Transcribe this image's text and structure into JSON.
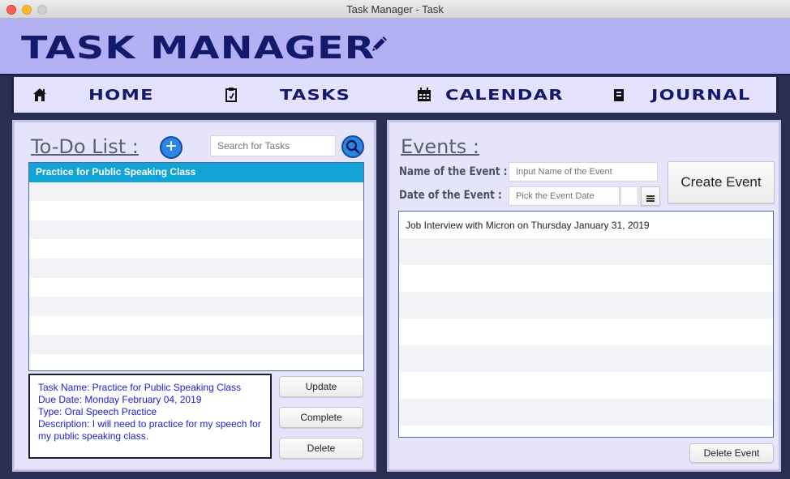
{
  "window": {
    "title": "Task Manager - Task"
  },
  "header": {
    "brand": "TASK MANAGER",
    "brand_icon": "pencil-icon"
  },
  "nav": [
    {
      "label": "HOME",
      "icon": "home-icon"
    },
    {
      "label": "TASKS",
      "icon": "clipboard-icon"
    },
    {
      "label": "CALENDAR",
      "icon": "calendar-icon"
    },
    {
      "label": "JOURNAL",
      "icon": "journal-icon"
    }
  ],
  "todo": {
    "heading": "To-Do List :",
    "search_placeholder": "Search for Tasks",
    "items": [
      "Practice for Public Speaking Class"
    ],
    "details": {
      "name": "Task Name: Practice for Public Speaking Class",
      "due": "Due Date: Monday February 04, 2019",
      "type": "Type: Oral Speech Practice",
      "description": "Description: I will need to practice for my speech for my public speaking class."
    },
    "buttons": {
      "update": "Update",
      "complete": "Complete",
      "delete": "Delete"
    }
  },
  "events": {
    "heading": "Events :",
    "name_label": "Name of the Event :",
    "name_placeholder": "Input Name of the Event",
    "date_label": "Date of the Event :",
    "date_placeholder": "Pick the Event Date",
    "create_button": "Create Event",
    "items": [
      "Job Interview with Micron on Thursday January 31, 2019"
    ],
    "delete_button": "Delete Event"
  },
  "colors": {
    "accent": "#131a6c",
    "header_bg": "#b4b0f4",
    "selection": "#12a4d7",
    "detail_text": "#2020d8"
  }
}
